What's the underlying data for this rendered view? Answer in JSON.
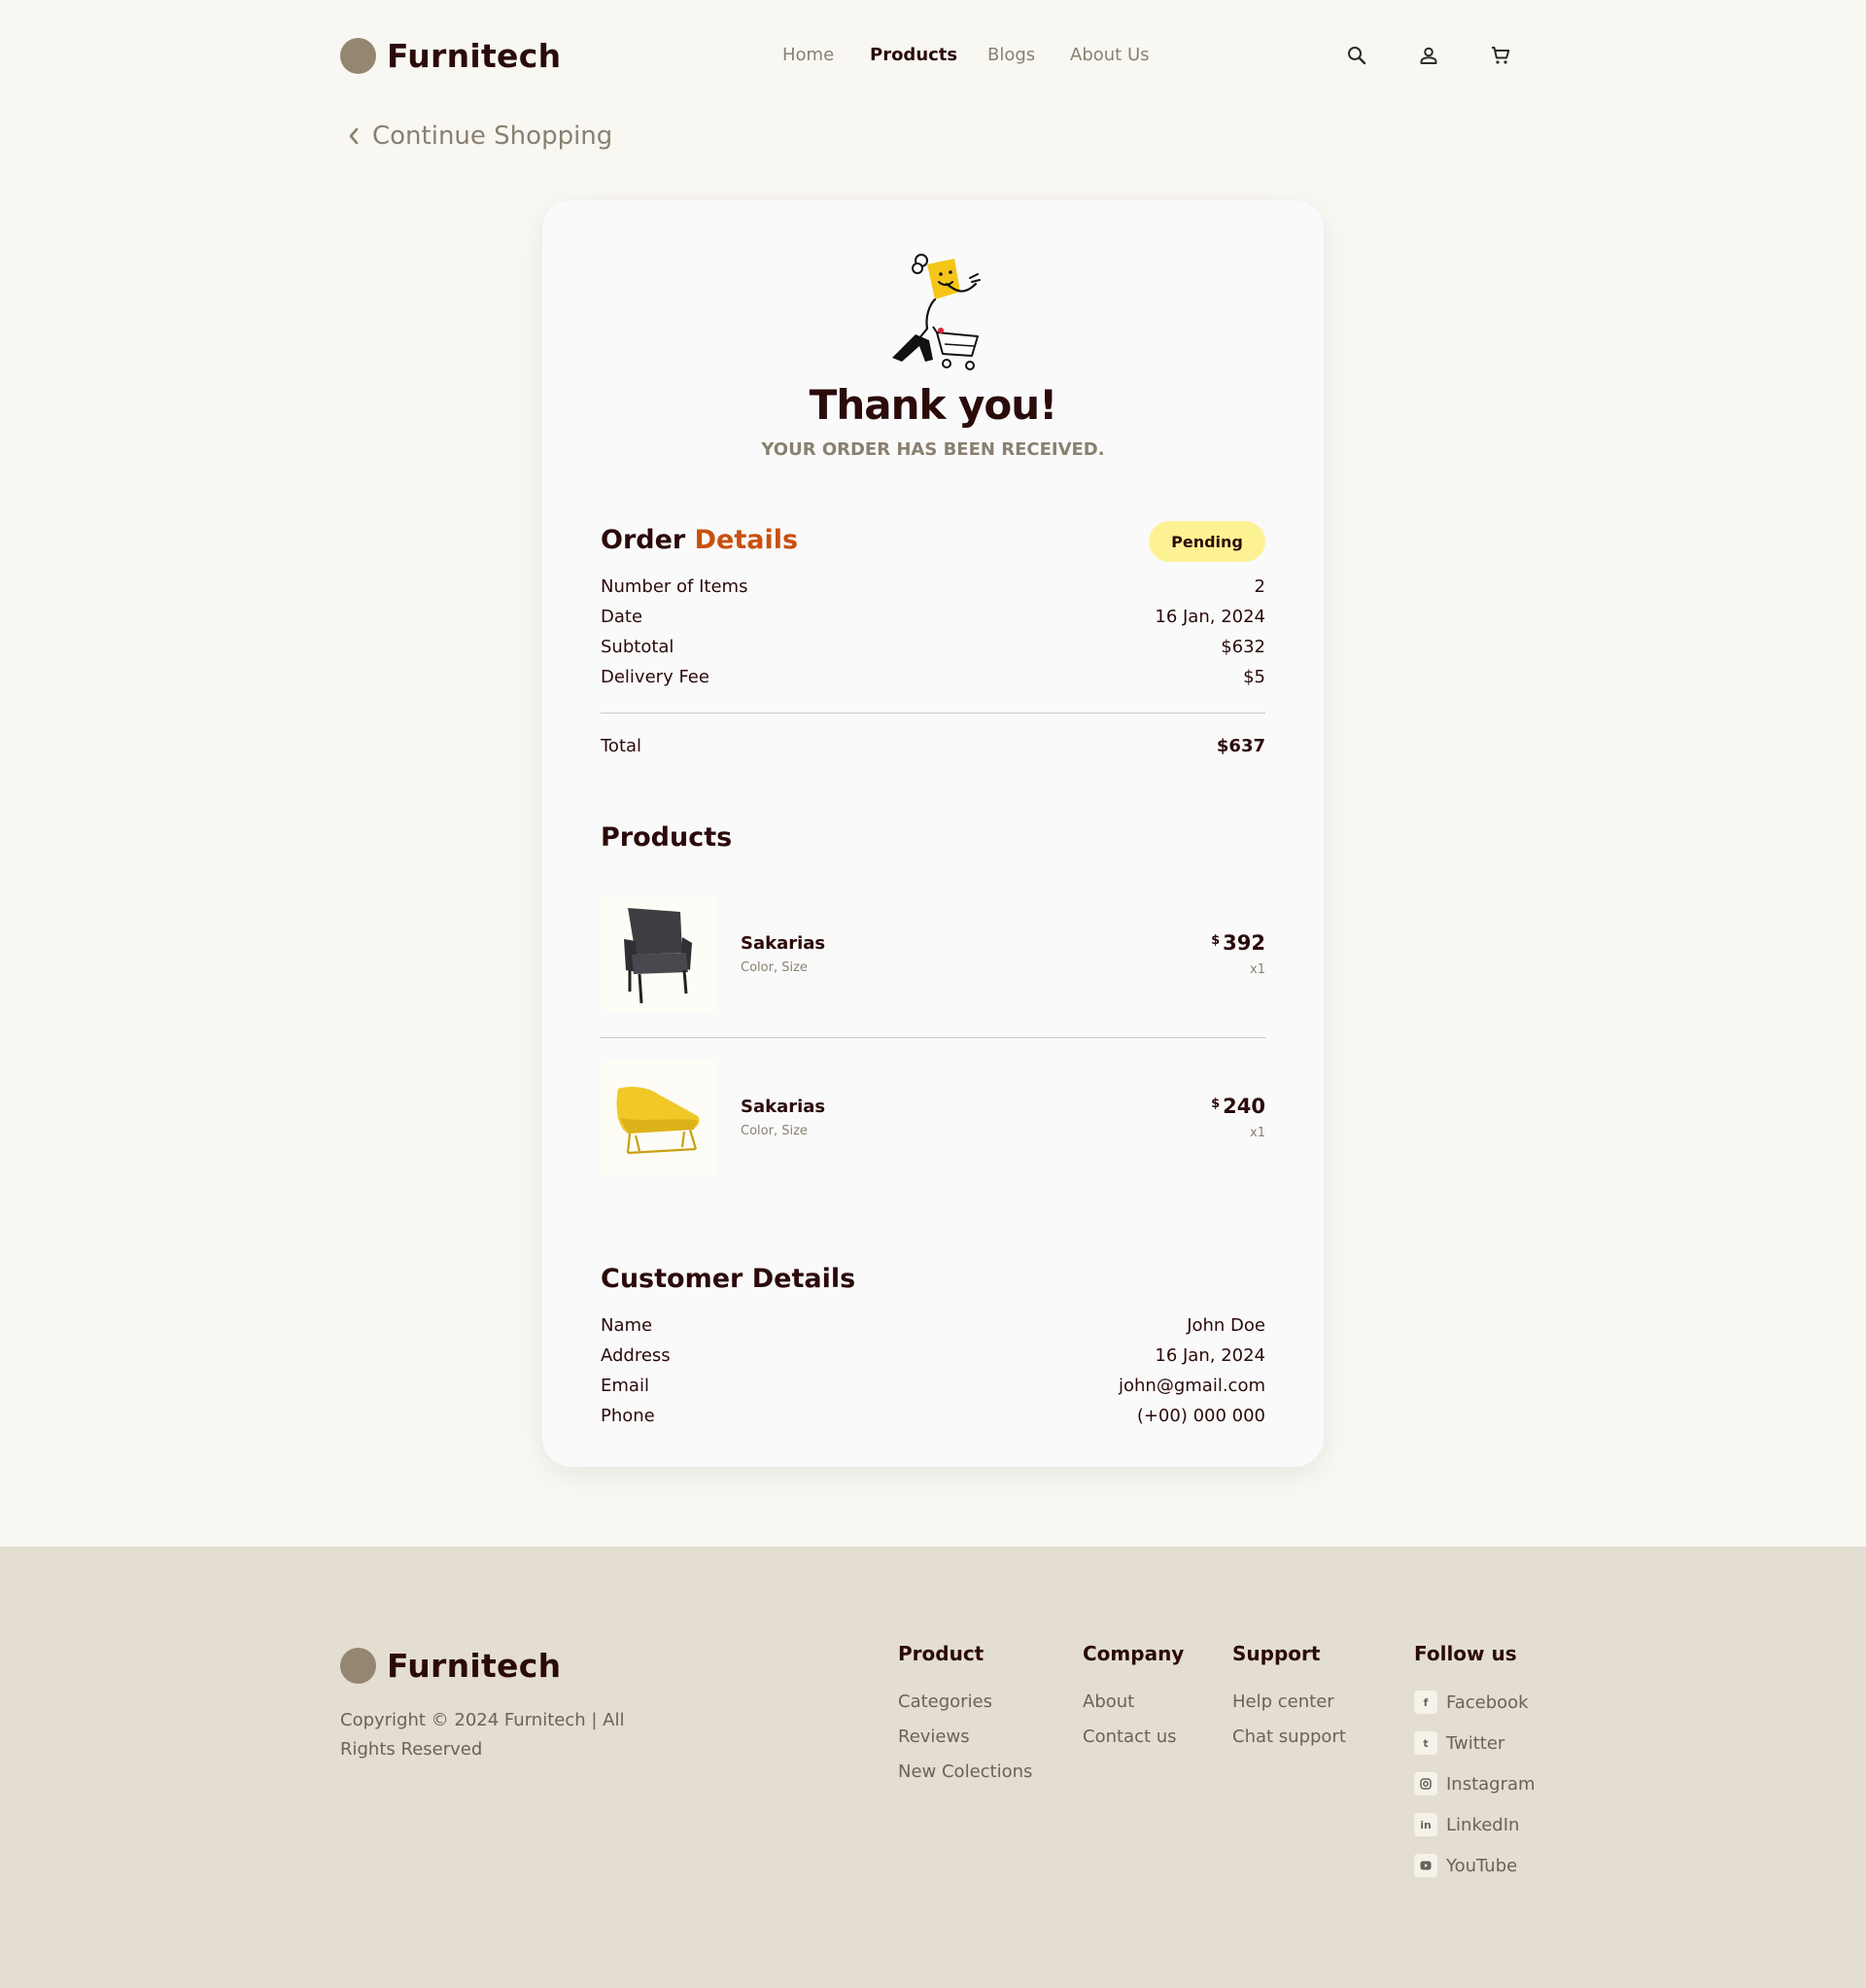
{
  "brand": {
    "name": "Furnitech"
  },
  "nav": {
    "items": [
      "Home",
      "Products",
      "Blogs",
      "About Us"
    ],
    "active": "Products"
  },
  "back_link": {
    "label": "Continue Shopping"
  },
  "confirmation": {
    "title": "Thank you!",
    "subtitle": "YOUR ORDER HAS BEEN RECEIVED."
  },
  "order": {
    "title_part1": "Order",
    "title_part2": "Details",
    "status": "Pending",
    "rows": [
      {
        "label": "Number of Items",
        "value": "2"
      },
      {
        "label": "Date",
        "value": "16 Jan, 2024"
      },
      {
        "label": "Subtotal",
        "value": "$632"
      },
      {
        "label": "Delivery Fee",
        "value": "$5"
      }
    ],
    "total_label": "Total",
    "total_value": "$637"
  },
  "products": {
    "title": "Products",
    "items": [
      {
        "name": "Sakarias",
        "meta": "Color, Size",
        "currency": "$",
        "price": "392",
        "qty": "x1"
      },
      {
        "name": "Sakarias",
        "meta": "Color, Size",
        "currency": "$",
        "price": "240",
        "qty": "x1"
      }
    ]
  },
  "customer": {
    "title": "Customer Details",
    "rows": [
      {
        "label": "Name",
        "value": "John Doe"
      },
      {
        "label": "Address",
        "value": "16 Jan, 2024"
      },
      {
        "label": "Email",
        "value": "john@gmail.com"
      },
      {
        "label": "Phone",
        "value": "(+00) 000 000"
      }
    ]
  },
  "footer": {
    "brand": "Furnitech",
    "copyright": "Copyright © 2024 Furnitech | All Rights Reserved",
    "columns": [
      {
        "title": "Product",
        "links": [
          "Categories",
          "Reviews",
          "New Colections"
        ]
      },
      {
        "title": "Company",
        "links": [
          "About",
          "Contact us"
        ]
      },
      {
        "title": "Support",
        "links": [
          "Help center",
          "Chat support"
        ]
      }
    ],
    "follow": {
      "title": "Follow us",
      "links": [
        {
          "label": "Facebook",
          "icon": "facebook-icon"
        },
        {
          "label": "Twitter",
          "icon": "twitter-icon"
        },
        {
          "label": "Instagram",
          "icon": "instagram-icon"
        },
        {
          "label": "LinkedIn",
          "icon": "linkedin-icon"
        },
        {
          "label": "YouTube",
          "icon": "youtube-icon"
        }
      ]
    }
  },
  "colors": {
    "background": "#f9f7f2",
    "card": "#fafafa",
    "footer": "#e3ded1",
    "text_dark": "#2b0a0a",
    "text_muted": "#8a8070",
    "accent": "#c9500d",
    "badge": "#fdf293",
    "logo_dot": "#948670"
  }
}
